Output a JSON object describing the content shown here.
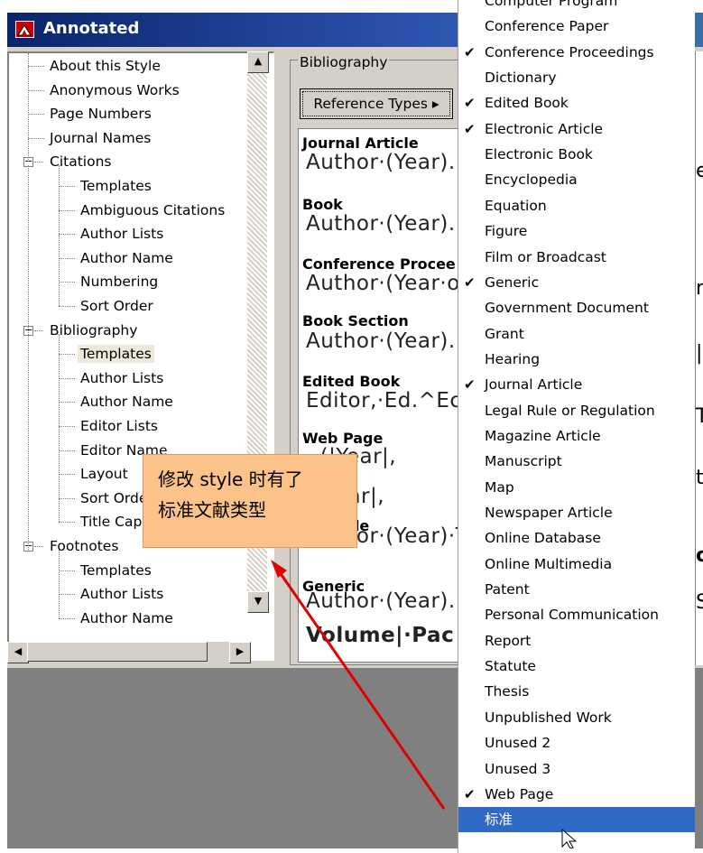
{
  "window": {
    "title": "Annotated"
  },
  "tree": {
    "items": [
      {
        "label": "About this Style",
        "level": 1
      },
      {
        "label": "Anonymous Works",
        "level": 1
      },
      {
        "label": "Page Numbers",
        "level": 1
      },
      {
        "label": "Journal Names",
        "level": 1
      },
      {
        "label": "Citations",
        "level": 0,
        "expanded": true
      },
      {
        "label": "Templates",
        "level": 2
      },
      {
        "label": "Ambiguous Citations",
        "level": 2
      },
      {
        "label": "Author Lists",
        "level": 2
      },
      {
        "label": "Author Name",
        "level": 2
      },
      {
        "label": "Numbering",
        "level": 2
      },
      {
        "label": "Sort Order",
        "level": 2
      },
      {
        "label": "Bibliography",
        "level": 0,
        "expanded": true
      },
      {
        "label": "Templates",
        "level": 2,
        "selected": true
      },
      {
        "label": "Author Lists",
        "level": 2
      },
      {
        "label": "Author Name",
        "level": 2
      },
      {
        "label": "Editor Lists",
        "level": 2
      },
      {
        "label": "Editor Name",
        "level": 2
      },
      {
        "label": "Layout",
        "level": 2
      },
      {
        "label": "Sort Orde",
        "level": 2
      },
      {
        "label": "Title Cap",
        "level": 2
      },
      {
        "label": "Footnotes",
        "level": 0,
        "expanded": true
      },
      {
        "label": "Templates",
        "level": 2
      },
      {
        "label": "Author Lists",
        "level": 2
      },
      {
        "label": "Author Name",
        "level": 2
      }
    ],
    "collapse_glyph": "−"
  },
  "bibliography": {
    "legend": "Bibliography",
    "ref_types_button": "Reference Types ▸",
    "entries": [
      {
        "title": "Journal Article",
        "template": "Author·(Year).·"
      },
      {
        "title": "Book",
        "template": "Author·(Year).·"
      },
      {
        "title": "Conference Procee",
        "template": "Author·(Year·o"
      },
      {
        "title": "Book Section",
        "template": "Author·(Year).·"
      },
      {
        "title": "Edited Book",
        "template": "Editor,·Ed.^Ec"
      },
      {
        "title": "Web Page",
        "template": "··(|Year|,"
      },
      {
        "title": "",
        "template": "s·Year|,"
      },
      {
        "title": "c Article",
        "template": "Author·(Year)·T"
      },
      {
        "title": "Generic",
        "template": "Author·(Year).·"
      },
      {
        "title": "",
        "template": "Volume|·Pac"
      }
    ]
  },
  "right_panel_chars": [
    "e",
    "r",
    "|",
    "T",
    "t",
    "o",
    "S"
  ],
  "menu": {
    "items": [
      {
        "label": "Computer Program",
        "checked": false
      },
      {
        "label": "Conference Paper",
        "checked": false
      },
      {
        "label": "Conference Proceedings",
        "checked": true
      },
      {
        "label": "Dictionary",
        "checked": false
      },
      {
        "label": "Edited Book",
        "checked": true
      },
      {
        "label": "Electronic Article",
        "checked": true
      },
      {
        "label": "Electronic Book",
        "checked": false
      },
      {
        "label": "Encyclopedia",
        "checked": false
      },
      {
        "label": "Equation",
        "checked": false
      },
      {
        "label": "Figure",
        "checked": false
      },
      {
        "label": "Film or Broadcast",
        "checked": false
      },
      {
        "label": "Generic",
        "checked": true
      },
      {
        "label": "Government Document",
        "checked": false
      },
      {
        "label": "Grant",
        "checked": false
      },
      {
        "label": "Hearing",
        "checked": false
      },
      {
        "label": "Journal Article",
        "checked": true
      },
      {
        "label": "Legal Rule or Regulation",
        "checked": false
      },
      {
        "label": "Magazine Article",
        "checked": false
      },
      {
        "label": "Manuscript",
        "checked": false
      },
      {
        "label": "Map",
        "checked": false
      },
      {
        "label": "Newspaper Article",
        "checked": false
      },
      {
        "label": "Online Database",
        "checked": false
      },
      {
        "label": "Online Multimedia",
        "checked": false
      },
      {
        "label": "Patent",
        "checked": false
      },
      {
        "label": "Personal Communication",
        "checked": false
      },
      {
        "label": "Report",
        "checked": false
      },
      {
        "label": "Statute",
        "checked": false
      },
      {
        "label": "Thesis",
        "checked": false
      },
      {
        "label": "Unpublished Work",
        "checked": false
      },
      {
        "label": "Unused 2",
        "checked": false
      },
      {
        "label": "Unused 3",
        "checked": false
      },
      {
        "label": "Web Page",
        "checked": true
      },
      {
        "label": "标准",
        "checked": false,
        "highlighted": true
      }
    ],
    "check_glyph": "✔"
  },
  "callout": {
    "line1": "修改 style 时有了",
    "line2": "标准文献类型"
  },
  "colors": {
    "title_bar": "#0a246a",
    "callout_bg": "#fbc28a",
    "arrow": "#e00000",
    "menu_highlight": "#316ac5"
  }
}
